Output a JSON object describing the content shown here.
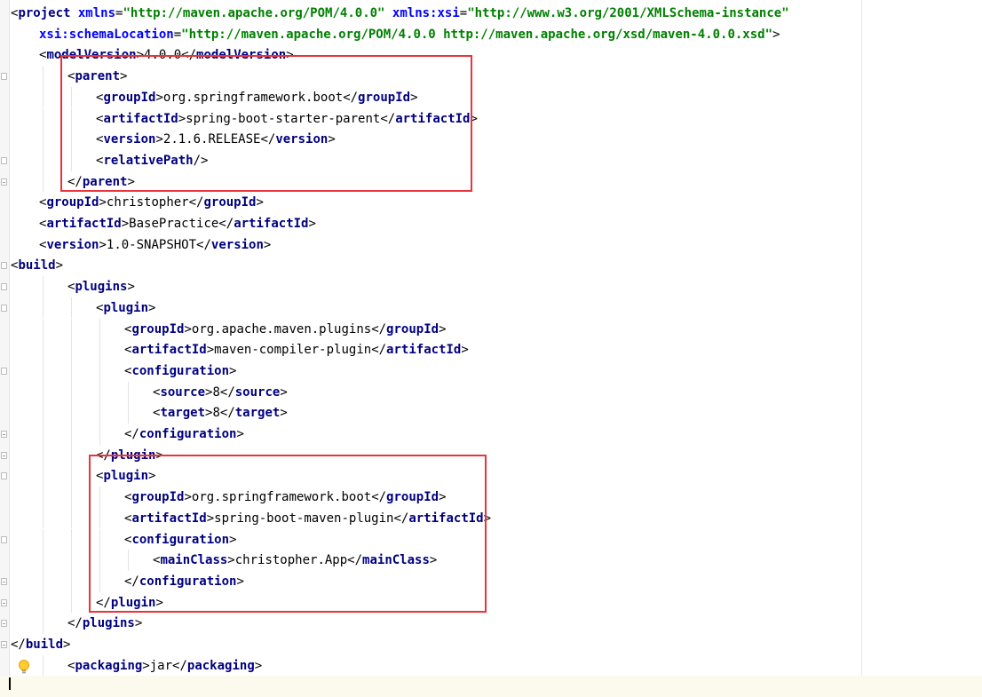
{
  "editor": {
    "lines": [
      {
        "indent": 0,
        "current": false,
        "tokens": [
          {
            "t": "b",
            "v": "<"
          },
          {
            "t": "t",
            "v": "project "
          },
          {
            "t": "n",
            "v": "xmlns"
          },
          {
            "t": "x",
            "v": "="
          },
          {
            "t": "v",
            "v": "\"http://maven.apache.org/POM/4.0.0\" "
          },
          {
            "t": "n",
            "v": "xmlns:xsi"
          },
          {
            "t": "x",
            "v": "="
          },
          {
            "t": "v",
            "v": "\"http://www.w3.org/2001/XMLSchema-instance\""
          }
        ]
      },
      {
        "indent": 1,
        "current": false,
        "tokens": [
          {
            "t": "n",
            "v": "xsi:schemaLocation"
          },
          {
            "t": "x",
            "v": "="
          },
          {
            "t": "v",
            "v": "\"http://maven.apache.org/POM/4.0.0 http://maven.apache.org/xsd/maven-4.0.0.xsd\""
          },
          {
            "t": "b",
            "v": ">"
          }
        ]
      },
      {
        "indent": 1,
        "current": false,
        "tokens": [
          {
            "t": "b",
            "v": "<"
          },
          {
            "t": "t",
            "v": "modelVersion"
          },
          {
            "t": "b",
            "v": ">"
          },
          {
            "t": "x",
            "v": "4.0.0"
          },
          {
            "t": "b",
            "v": "</"
          },
          {
            "t": "t",
            "v": "modelVersion"
          },
          {
            "t": "b",
            "v": ">"
          }
        ]
      },
      {
        "indent": 2,
        "current": false,
        "tokens": [
          {
            "t": "b",
            "v": "<"
          },
          {
            "t": "t",
            "v": "parent"
          },
          {
            "t": "b",
            "v": ">"
          }
        ]
      },
      {
        "indent": 3,
        "current": false,
        "tokens": [
          {
            "t": "b",
            "v": "<"
          },
          {
            "t": "t",
            "v": "groupId"
          },
          {
            "t": "b",
            "v": ">"
          },
          {
            "t": "x",
            "v": "org.springframework.boot"
          },
          {
            "t": "b",
            "v": "</"
          },
          {
            "t": "t",
            "v": "groupId"
          },
          {
            "t": "b",
            "v": ">"
          }
        ]
      },
      {
        "indent": 3,
        "current": false,
        "tokens": [
          {
            "t": "b",
            "v": "<"
          },
          {
            "t": "t",
            "v": "artifactId"
          },
          {
            "t": "b",
            "v": ">"
          },
          {
            "t": "x",
            "v": "spring-boot-starter-parent"
          },
          {
            "t": "b",
            "v": "</"
          },
          {
            "t": "t",
            "v": "artifactId"
          },
          {
            "t": "b",
            "v": ">"
          }
        ]
      },
      {
        "indent": 3,
        "current": false,
        "tokens": [
          {
            "t": "b",
            "v": "<"
          },
          {
            "t": "t",
            "v": "version"
          },
          {
            "t": "b",
            "v": ">"
          },
          {
            "t": "x",
            "v": "2.1.6.RELEASE"
          },
          {
            "t": "b",
            "v": "</"
          },
          {
            "t": "t",
            "v": "version"
          },
          {
            "t": "b",
            "v": ">"
          }
        ]
      },
      {
        "indent": 3,
        "current": false,
        "tokens": [
          {
            "t": "b",
            "v": "<"
          },
          {
            "t": "t",
            "v": "relativePath"
          },
          {
            "t": "b",
            "v": "/>"
          }
        ]
      },
      {
        "indent": 2,
        "current": false,
        "tokens": [
          {
            "t": "b",
            "v": "</"
          },
          {
            "t": "t",
            "v": "parent"
          },
          {
            "t": "b",
            "v": ">"
          }
        ]
      },
      {
        "indent": 1,
        "current": false,
        "tokens": [
          {
            "t": "b",
            "v": "<"
          },
          {
            "t": "t",
            "v": "groupId"
          },
          {
            "t": "b",
            "v": ">"
          },
          {
            "t": "x",
            "v": "christopher"
          },
          {
            "t": "b",
            "v": "</"
          },
          {
            "t": "t",
            "v": "groupId"
          },
          {
            "t": "b",
            "v": ">"
          }
        ]
      },
      {
        "indent": 1,
        "current": false,
        "tokens": [
          {
            "t": "b",
            "v": "<"
          },
          {
            "t": "t",
            "v": "artifactId"
          },
          {
            "t": "b",
            "v": ">"
          },
          {
            "t": "x",
            "v": "BasePractice"
          },
          {
            "t": "b",
            "v": "</"
          },
          {
            "t": "t",
            "v": "artifactId"
          },
          {
            "t": "b",
            "v": ">"
          }
        ]
      },
      {
        "indent": 1,
        "current": false,
        "tokens": [
          {
            "t": "b",
            "v": "<"
          },
          {
            "t": "t",
            "v": "version"
          },
          {
            "t": "b",
            "v": ">"
          },
          {
            "t": "x",
            "v": "1.0-SNAPSHOT"
          },
          {
            "t": "b",
            "v": "</"
          },
          {
            "t": "t",
            "v": "version"
          },
          {
            "t": "b",
            "v": ">"
          }
        ]
      },
      {
        "indent": 0,
        "current": false,
        "tokens": [
          {
            "t": "b",
            "v": "<"
          },
          {
            "t": "t",
            "v": "build"
          },
          {
            "t": "b",
            "v": ">"
          }
        ]
      },
      {
        "indent": 2,
        "current": false,
        "tokens": [
          {
            "t": "b",
            "v": "<"
          },
          {
            "t": "t",
            "v": "plugins"
          },
          {
            "t": "b",
            "v": ">"
          }
        ]
      },
      {
        "indent": 3,
        "current": false,
        "tokens": [
          {
            "t": "b",
            "v": "<"
          },
          {
            "t": "t",
            "v": "plugin"
          },
          {
            "t": "b",
            "v": ">"
          }
        ]
      },
      {
        "indent": 4,
        "current": false,
        "tokens": [
          {
            "t": "b",
            "v": "<"
          },
          {
            "t": "t",
            "v": "groupId"
          },
          {
            "t": "b",
            "v": ">"
          },
          {
            "t": "x",
            "v": "org.apache.maven.plugins"
          },
          {
            "t": "b",
            "v": "</"
          },
          {
            "t": "t",
            "v": "groupId"
          },
          {
            "t": "b",
            "v": ">"
          }
        ]
      },
      {
        "indent": 4,
        "current": false,
        "tokens": [
          {
            "t": "b",
            "v": "<"
          },
          {
            "t": "t",
            "v": "artifactId"
          },
          {
            "t": "b",
            "v": ">"
          },
          {
            "t": "x",
            "v": "maven-compiler-plugin"
          },
          {
            "t": "b",
            "v": "</"
          },
          {
            "t": "t",
            "v": "artifactId"
          },
          {
            "t": "b",
            "v": ">"
          }
        ]
      },
      {
        "indent": 4,
        "current": false,
        "tokens": [
          {
            "t": "b",
            "v": "<"
          },
          {
            "t": "t",
            "v": "configuration"
          },
          {
            "t": "b",
            "v": ">"
          }
        ]
      },
      {
        "indent": 5,
        "current": false,
        "tokens": [
          {
            "t": "b",
            "v": "<"
          },
          {
            "t": "t",
            "v": "source"
          },
          {
            "t": "b",
            "v": ">"
          },
          {
            "t": "x",
            "v": "8"
          },
          {
            "t": "b",
            "v": "</"
          },
          {
            "t": "t",
            "v": "source"
          },
          {
            "t": "b",
            "v": ">"
          }
        ]
      },
      {
        "indent": 5,
        "current": false,
        "tokens": [
          {
            "t": "b",
            "v": "<"
          },
          {
            "t": "t",
            "v": "target"
          },
          {
            "t": "b",
            "v": ">"
          },
          {
            "t": "x",
            "v": "8"
          },
          {
            "t": "b",
            "v": "</"
          },
          {
            "t": "t",
            "v": "target"
          },
          {
            "t": "b",
            "v": ">"
          }
        ]
      },
      {
        "indent": 4,
        "current": false,
        "tokens": [
          {
            "t": "b",
            "v": "</"
          },
          {
            "t": "t",
            "v": "configuration"
          },
          {
            "t": "b",
            "v": ">"
          }
        ]
      },
      {
        "indent": 3,
        "current": false,
        "tokens": [
          {
            "t": "b",
            "v": "</"
          },
          {
            "t": "t",
            "v": "plugin"
          },
          {
            "t": "b",
            "v": ">"
          }
        ]
      },
      {
        "indent": 3,
        "current": false,
        "tokens": [
          {
            "t": "b",
            "v": "<"
          },
          {
            "t": "t",
            "v": "plugin"
          },
          {
            "t": "b",
            "v": ">"
          }
        ]
      },
      {
        "indent": 4,
        "current": false,
        "tokens": [
          {
            "t": "b",
            "v": "<"
          },
          {
            "t": "t",
            "v": "groupId"
          },
          {
            "t": "b",
            "v": ">"
          },
          {
            "t": "x",
            "v": "org.springframework.boot"
          },
          {
            "t": "b",
            "v": "</"
          },
          {
            "t": "t",
            "v": "groupId"
          },
          {
            "t": "b",
            "v": ">"
          }
        ]
      },
      {
        "indent": 4,
        "current": false,
        "tokens": [
          {
            "t": "b",
            "v": "<"
          },
          {
            "t": "t",
            "v": "artifactId"
          },
          {
            "t": "b",
            "v": ">"
          },
          {
            "t": "x",
            "v": "spring-boot-maven-plugin"
          },
          {
            "t": "b",
            "v": "</"
          },
          {
            "t": "t",
            "v": "artifactId"
          },
          {
            "t": "b",
            "v": ">"
          }
        ]
      },
      {
        "indent": 4,
        "current": false,
        "tokens": [
          {
            "t": "b",
            "v": "<"
          },
          {
            "t": "t",
            "v": "configuration"
          },
          {
            "t": "b",
            "v": ">"
          }
        ]
      },
      {
        "indent": 5,
        "current": false,
        "tokens": [
          {
            "t": "b",
            "v": "<"
          },
          {
            "t": "t",
            "v": "mainClass"
          },
          {
            "t": "b",
            "v": ">"
          },
          {
            "t": "x",
            "v": "christopher.App"
          },
          {
            "t": "b",
            "v": "</"
          },
          {
            "t": "t",
            "v": "mainClass"
          },
          {
            "t": "b",
            "v": ">"
          }
        ]
      },
      {
        "indent": 4,
        "current": false,
        "tokens": [
          {
            "t": "b",
            "v": "</"
          },
          {
            "t": "t",
            "v": "configuration"
          },
          {
            "t": "b",
            "v": ">"
          }
        ]
      },
      {
        "indent": 3,
        "current": false,
        "tokens": [
          {
            "t": "b",
            "v": "</"
          },
          {
            "t": "t",
            "v": "plugin"
          },
          {
            "t": "b",
            "v": ">"
          }
        ]
      },
      {
        "indent": 2,
        "current": false,
        "tokens": [
          {
            "t": "b",
            "v": "</"
          },
          {
            "t": "t",
            "v": "plugins"
          },
          {
            "t": "b",
            "v": ">"
          }
        ]
      },
      {
        "indent": 0,
        "current": false,
        "tokens": [
          {
            "t": "b",
            "v": "</"
          },
          {
            "t": "t",
            "v": "build"
          },
          {
            "t": "b",
            "v": ">"
          }
        ]
      },
      {
        "indent": 2,
        "current": false,
        "tokens": [
          {
            "t": "b",
            "v": "<"
          },
          {
            "t": "t",
            "v": "packaging"
          },
          {
            "t": "b",
            "v": ">"
          },
          {
            "t": "x",
            "v": "jar"
          },
          {
            "t": "b",
            "v": "</"
          },
          {
            "t": "t",
            "v": "packaging"
          },
          {
            "t": "b",
            "v": ">"
          }
        ]
      },
      {
        "indent": 0,
        "current": true,
        "tokens": []
      }
    ],
    "highlights": [
      {
        "from_line": 3,
        "to_line": 8,
        "color": "#e8353d"
      },
      {
        "from_line": 22,
        "to_line": 28,
        "color": "#e8353d"
      }
    ],
    "intention_icon": "lightbulb-icon"
  }
}
